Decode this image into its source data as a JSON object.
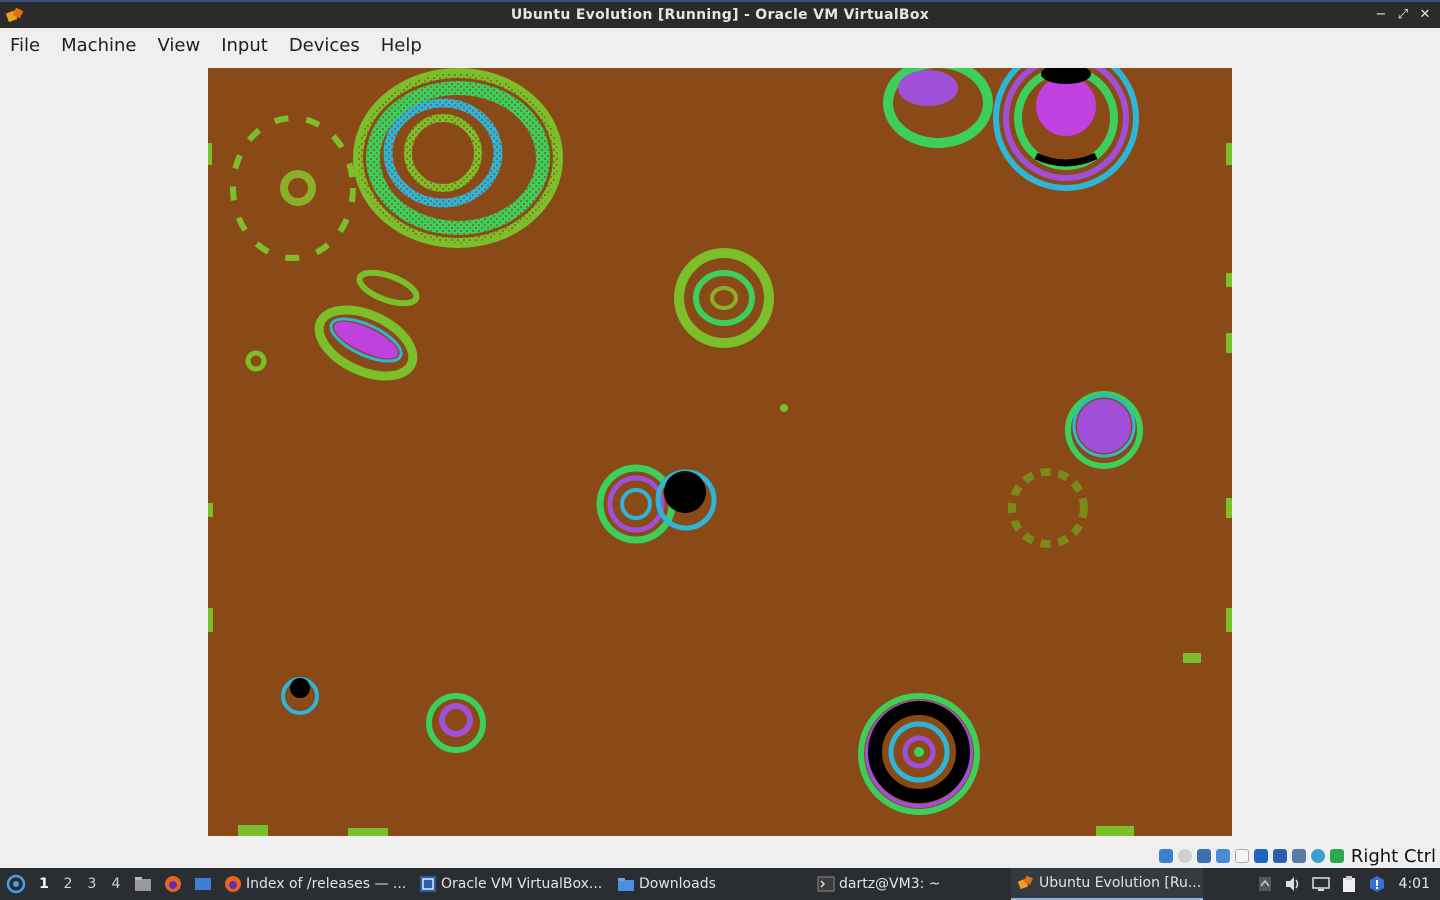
{
  "window": {
    "title": "Ubuntu Evolution [Running] - Oracle VM VirtualBox",
    "controls": {
      "minimize": "−",
      "restore": "⤢",
      "close": "✕"
    }
  },
  "menu": {
    "items": [
      "File",
      "Machine",
      "View",
      "Input",
      "Devices",
      "Help"
    ]
  },
  "vm_display": {
    "background_color": "#8a4a18",
    "description_icon": "guest-screen"
  },
  "statusbar": {
    "host_key": "Right Ctrl",
    "icons": [
      "hard-disk-icon",
      "optical-drive-icon",
      "audio-icon",
      "network-icon",
      "usb-icon",
      "shared-folders-icon",
      "display-icon",
      "video-capture-icon",
      "recording-icon",
      "cpu-icon",
      "mouse-integration-icon",
      "keyboard-icon"
    ]
  },
  "taskbar": {
    "workspaces": [
      "1",
      "2",
      "3",
      "4"
    ],
    "active_workspace": "1",
    "tasks": [
      {
        "label": "Index of /releases — ...",
        "icon": "firefox-icon"
      },
      {
        "label": "Oracle VM VirtualBox...",
        "icon": "virtualbox-manager-icon"
      },
      {
        "label": "Downloads",
        "icon": "folder-icon"
      },
      {
        "label": "dartz@VM3: ~",
        "icon": "terminal-icon"
      },
      {
        "label": "Ubuntu Evolution [Ru...",
        "icon": "virtualbox-vm-icon"
      }
    ],
    "clock": "4:01"
  },
  "colors": {
    "titlebar": "#2b2b2b",
    "taskbar": "#2a2e33",
    "accent": "#8fb3d9"
  }
}
